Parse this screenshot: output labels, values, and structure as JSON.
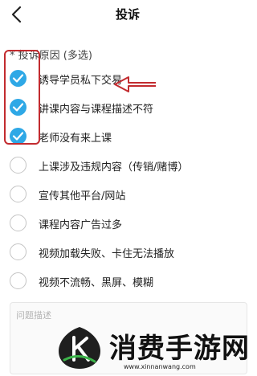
{
  "header": {
    "title": "投诉",
    "back_icon": "chevron-left-icon"
  },
  "section": {
    "label": "* 投诉原因 (多选)"
  },
  "accent_color": "#2ea8e6",
  "annotation_color": "#c22b2f",
  "options": [
    {
      "label": "诱导学员私下交易",
      "checked": true
    },
    {
      "label": "讲课内容与课程描述不符",
      "checked": true
    },
    {
      "label": "老师没有来上课",
      "checked": true
    },
    {
      "label": "上课涉及违规内容（传销/赌博）",
      "checked": false
    },
    {
      "label": "宣传其他平台/网站",
      "checked": false
    },
    {
      "label": "课程内容广告过多",
      "checked": false
    },
    {
      "label": "视频加载失败、卡住无法播放",
      "checked": false
    },
    {
      "label": "视频不流畅、黑屏、模糊",
      "checked": false
    }
  ],
  "description": {
    "placeholder": "问题描述"
  },
  "watermark": {
    "text": "消费手游网",
    "url": "www.xinnanwang.com"
  }
}
